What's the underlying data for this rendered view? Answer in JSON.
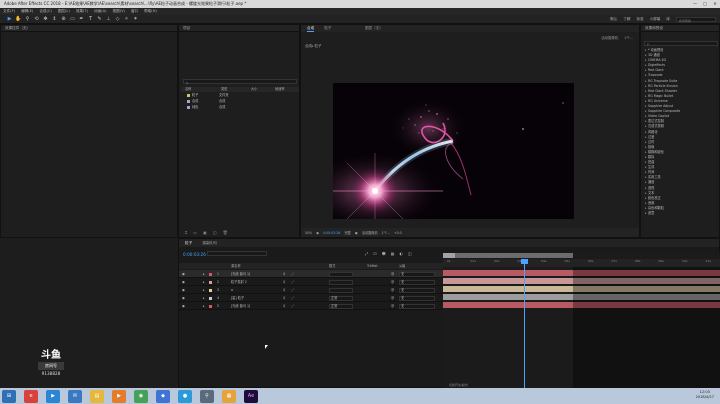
{
  "window": {
    "title": "Adobe After Effects CC 2018 - E:\\AE效果\\AE教学\\AE\\search\\素材\\search\\...\\fly\\AE粒子动画合成 - 螺旋光效果粒子滑行\\粒子.aep *",
    "controls": [
      "—",
      "□",
      "✕"
    ]
  },
  "menu": [
    "文件(F)",
    "编辑(E)",
    "合成(C)",
    "图层(L)",
    "效果(T)",
    "动画(A)",
    "视图(V)",
    "窗口",
    "帮助(H)"
  ],
  "toolbar": {
    "tools": [
      "selection-tool",
      "hand-tool",
      "zoom-tool",
      "orbit-tool",
      "pan-tool",
      "dolly-tool",
      "pan-behind-tool",
      "rectangle-tool",
      "pen-tool",
      "type-tool",
      "brush-tool",
      "clone-tool",
      "eraser-tool",
      "roto-tool",
      "puppet-tool"
    ],
    "right_items": [
      "默认",
      "了解",
      "标准",
      "小屏幕",
      "库"
    ],
    "search_label": "搜索帮助"
  },
  "left_panel": {
    "tab": "效果控件（无）"
  },
  "project_panel": {
    "tab": "项目",
    "search_placeholder": "ρ.",
    "columns": [
      "名称",
      "类型",
      "大小",
      "帧速率"
    ],
    "rows": [
      {
        "name": "粒子",
        "type": "文件夹",
        "color": "#d6c65a"
      },
      {
        "name": "合成",
        "type": "合成",
        "color": "#a9a0d8"
      },
      {
        "name": "纯色",
        "type": "合成",
        "color": "#a9a0d8"
      }
    ],
    "bottom_icons": [
      "interpret-footage-icon",
      "new-folder-icon",
      "new-comp-icon",
      "bit-depth-icon",
      "trash-icon"
    ]
  },
  "comp_panel": {
    "tabs": [
      "合成",
      "粒子"
    ],
    "layer_tab": "图层（无）",
    "subtab": "粒子▸ 合成",
    "breadcrumb": "合成▸ 粒子",
    "right_tabs": [
      "活动摄像机",
      "1个..."
    ],
    "footer": {
      "zoom": "50%",
      "timecode": "0:00:03:26",
      "resolution": "完整",
      "camera": "活动摄像机",
      "views": "1个...",
      "offset": "+0.0"
    }
  },
  "effects_panel": {
    "tab": "效果和预设",
    "title": "效果和预设",
    "search_placeholder": "ρ.",
    "items": [
      "* 动画预设",
      "3D 通道",
      "CINEMA 4D",
      "Digieffects",
      "Red Giant",
      "Trapcode",
      "RG Trapcode Suite",
      "RG Particle Illusion",
      "Red Giant Shooter",
      "RG Magic Bullet",
      "RG Universe",
      "Sapphire Adjust",
      "Sapphire Composite",
      "Video Copilot",
      "表达式控制",
      "沉浸式视频",
      "风格化",
      "过渡",
      "过时",
      "抠像",
      "模糊和锐化",
      "模拟",
      "扭曲",
      "生成",
      "时间",
      "实用工具",
      "通道",
      "透视",
      "文本",
      "颜色校正",
      "音频",
      "杂色和颗粒",
      "遮罩"
    ]
  },
  "timeline": {
    "tabs": [
      "粒子",
      "渲染队列"
    ],
    "time": "0:00:03:26",
    "columns": [
      "图层名称",
      "单",
      "父级"
    ],
    "header_labels": {
      "name": "源名称",
      "mode": "模式",
      "trkmat": "TrkMat",
      "parent": "父级"
    },
    "rows": [
      {
        "num": "1",
        "name": "[光线 伽马 1]",
        "color": "#d7576a",
        "mode": "",
        "parent": "无"
      },
      {
        "num": "2",
        "name": "粒子发射 2",
        "color": "#d7a0a0",
        "mode": "",
        "parent": "无"
      },
      {
        "num": "3",
        "name": "a",
        "color": "#e0d0a0",
        "mode": "",
        "parent": "无"
      },
      {
        "num": "4",
        "name": "[星] 粒子",
        "color": "#c9c9c9",
        "mode": "正常",
        "parent": "无"
      },
      {
        "num": "5",
        "name": "[光线 伽马 1]",
        "color": "#d7576a",
        "mode": "正常",
        "parent": "无"
      }
    ],
    "ruler_labels": [
      "0s",
      "01s",
      "02s",
      "03s",
      "04s",
      "05s",
      "06s",
      "07s",
      "08s",
      "09s",
      "10s",
      "11s"
    ],
    "track_colors": [
      "#b85a64",
      "#c89898",
      "#c8b898",
      "#9c9c9c",
      "#b85a64"
    ],
    "footer": "切换开关/模式",
    "current_time_fraction": 0.29
  },
  "watermark": {
    "logo": "斗鱼",
    "tag": "房间号",
    "room": "9138828"
  },
  "taskbar": {
    "icons": [
      "start-icon",
      "browser-icon",
      "media-icon",
      "mail-icon",
      "folder-icon",
      "player-icon",
      "browser2-icon",
      "app-icon",
      "qq-icon",
      "search-app-icon",
      "explorer-icon",
      "ae-icon"
    ],
    "clock_time": "12:03",
    "clock_date": "2018/4/27"
  }
}
